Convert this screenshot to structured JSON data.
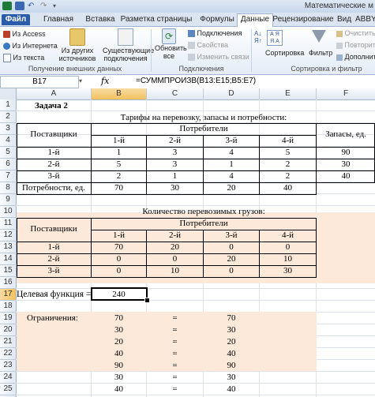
{
  "window": {
    "title": "Математические м"
  },
  "tabs": [
    "Файл",
    "Главная",
    "Вставка",
    "Разметка страницы",
    "Формулы",
    "Данные",
    "Рецензирование",
    "Вид",
    "ABBY"
  ],
  "ribbon": {
    "external": {
      "access": "Из Access",
      "web": "Из Интернета",
      "text": "Из текста",
      "other": "Из других источников",
      "existing": "Существующие подключения",
      "label": "Получение внешних данных"
    },
    "connections": {
      "refresh": "Обновить все",
      "connections": "Подключения",
      "properties": "Свойства",
      "edit_links": "Изменить связи",
      "label": "Подключения"
    },
    "sort": {
      "sort": "Сортировка",
      "filter": "Фильтр",
      "clear": "Очистить",
      "reapply": "Повторит",
      "advanced": "Дополнит",
      "label": "Сортировка и фильтр"
    }
  },
  "formula_bar": {
    "name_box": "B17",
    "fx": "fx",
    "formula": "=СУММПРОИЗВ(B13:E15;B5:E7)"
  },
  "columns": [
    "A",
    "B",
    "C",
    "D",
    "E",
    "F"
  ],
  "rows": [
    "1",
    "2",
    "3",
    "4",
    "5",
    "6",
    "7",
    "8",
    "9",
    "10",
    "11",
    "12",
    "13",
    "14",
    "15",
    "16",
    "17",
    "18",
    "19",
    "20",
    "21",
    "22",
    "23",
    "24",
    "25",
    "26"
  ],
  "sheet": {
    "task": "Задача 2",
    "t1_title": "Тарифы на перевозку, запасы и потребности:",
    "suppliers": "Поставщики",
    "consumers": "Потребители",
    "stock": "Запасы, ед.",
    "demand": "Потребности, ед.",
    "consumer_heads": [
      "1-й",
      "2-й",
      "3-й",
      "4-й"
    ],
    "supplier_heads": [
      "1-й",
      "2-й",
      "3-й"
    ],
    "tariffs": [
      [
        "1",
        "3",
        "4",
        "5"
      ],
      [
        "5",
        "3",
        "1",
        "2"
      ],
      [
        "2",
        "1",
        "4",
        "2"
      ]
    ],
    "stocks": [
      "90",
      "30",
      "40"
    ],
    "demands": [
      "70",
      "30",
      "20",
      "40"
    ],
    "t2_title": "Количество перевозимых грузов:",
    "shipments": [
      [
        "70",
        "20",
        "0",
        "0"
      ],
      [
        "0",
        "0",
        "20",
        "10"
      ],
      [
        "0",
        "10",
        "0",
        "30"
      ]
    ],
    "target_label": "Целевая функция =",
    "target_value": "240",
    "constraints_label": "Ограничения:",
    "constraints": [
      [
        "70",
        "=",
        "70"
      ],
      [
        "30",
        "=",
        "30"
      ],
      [
        "20",
        "=",
        "20"
      ],
      [
        "40",
        "=",
        "40"
      ],
      [
        "90",
        "=",
        "90"
      ],
      [
        "30",
        "=",
        "30"
      ],
      [
        "40",
        "=",
        "40"
      ]
    ]
  }
}
